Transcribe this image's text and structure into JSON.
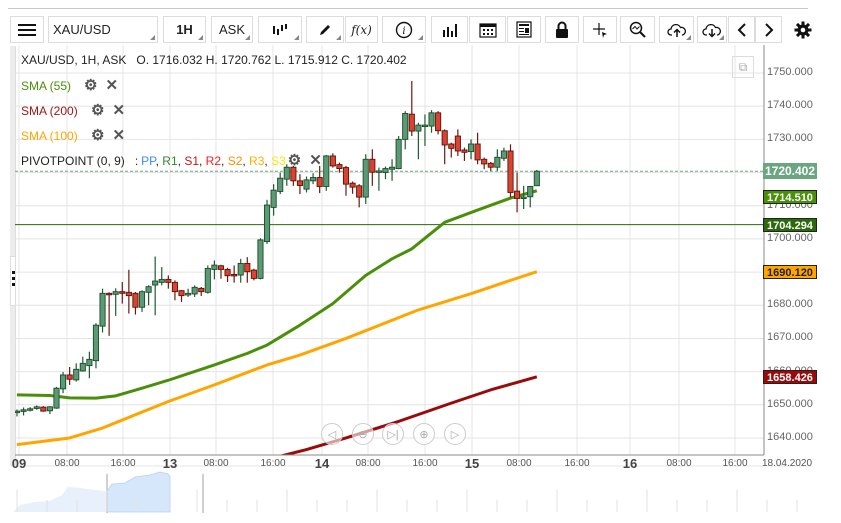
{
  "toolbar": {
    "menu_icon": "hamburger-icon",
    "symbol": "XAU/USD",
    "timeframe": "1H",
    "price_side": "ASK",
    "chart_type_icon": "candlestick-icon",
    "draw_icon": "pencil-icon",
    "indicator_label": "f(x)",
    "info_icon": "info-icon",
    "volume_icon": "bar-chart-icon",
    "calendar_icon": "calendar-icon",
    "news_icon": "newspaper-icon",
    "lock_icon": "lock-icon",
    "crosshair_icon": "crosshair-icon",
    "zoom_icon": "zoom-chart-icon",
    "upload_icon": "cloud-upload-icon",
    "download_icon": "cloud-download-icon",
    "prev_icon": "chevron-left-icon",
    "next_icon": "chevron-right-icon",
    "settings_icon": "gear-icon"
  },
  "header": {
    "title": "XAU/USD, 1H, ASK",
    "ohlc": "O. 1716.032 H. 1720.762 L. 1715.912 C. 1720.402"
  },
  "indicators": [
    {
      "label": "SMA (55)",
      "color": "#4a8f0a"
    },
    {
      "label": "SMA (200)",
      "color": "#a31515"
    },
    {
      "label": "SMA (100)",
      "color": "#ffa500"
    }
  ],
  "pivot": {
    "label": "PIVOTPOINT (0, 9)",
    "sep": ":",
    "levels": [
      {
        "label": "PP",
        "color": "#3b8cff"
      },
      {
        "label": "R1",
        "color": "#2f8a2f"
      },
      {
        "label": "S1",
        "color": "#c01818"
      },
      {
        "label": "R2",
        "color": "#ff1a1a"
      },
      {
        "label": "S2",
        "color": "#ff8c00"
      },
      {
        "label": "R3",
        "color": "#ffb000"
      },
      {
        "label": "S3",
        "color": "#ffe600"
      }
    ]
  },
  "chart_data": {
    "type": "candlestick",
    "ylim": [
      1635,
      1757
    ],
    "y_ticks": [
      "1750.000",
      "1740.000",
      "1730.000",
      "1720.000",
      "1710.000",
      "1700.000",
      "1690.000",
      "1680.000",
      "1670.000",
      "1660.000",
      "1650.000",
      "1640.000"
    ],
    "x_ticks": [
      {
        "label": "09",
        "day": true
      },
      {
        "label": "08:00"
      },
      {
        "label": "16:00"
      },
      {
        "label": "13",
        "day": true
      },
      {
        "label": "08:00"
      },
      {
        "label": "16:00"
      },
      {
        "label": "14",
        "day": true
      },
      {
        "label": "08:00"
      },
      {
        "label": "16:00"
      },
      {
        "label": "15",
        "day": true
      },
      {
        "label": "08:00"
      },
      {
        "label": "16:00"
      },
      {
        "label": "16",
        "day": true
      },
      {
        "label": "08:00"
      },
      {
        "label": "16:00"
      },
      {
        "label": "18.04.2020"
      }
    ],
    "up_color": "#5a9a74",
    "down_color": "#d9432f",
    "candles_ohlc": [
      [
        1647.8,
        1648.6,
        1646.5,
        1648.1
      ],
      [
        1648.0,
        1649.2,
        1646.8,
        1648.5
      ],
      [
        1648.5,
        1649.3,
        1648.0,
        1648.8
      ],
      [
        1648.9,
        1649.8,
        1648.5,
        1649.4
      ],
      [
        1649.3,
        1649.6,
        1647.9,
        1648.1
      ],
      [
        1648.2,
        1649.6,
        1647.2,
        1649.4
      ],
      [
        1649.0,
        1655.4,
        1648.8,
        1655.0
      ],
      [
        1654.8,
        1659.9,
        1653.5,
        1659.0
      ],
      [
        1659.0,
        1661.4,
        1656.0,
        1657.7
      ],
      [
        1657.5,
        1662.5,
        1657.0,
        1660.7
      ],
      [
        1660.2,
        1664.5,
        1660.0,
        1662.5
      ],
      [
        1661.8,
        1666.0,
        1658.0,
        1663.7
      ],
      [
        1663.3,
        1674.6,
        1661.0,
        1674.0
      ],
      [
        1673.7,
        1685.0,
        1671.8,
        1683.6
      ],
      [
        1683.6,
        1683.9,
        1670.8,
        1683.3
      ],
      [
        1683.3,
        1685.1,
        1676.8,
        1684.1
      ],
      [
        1684.1,
        1687.0,
        1680.5,
        1683.6
      ],
      [
        1683.9,
        1690.7,
        1677.5,
        1682.9
      ],
      [
        1683.6,
        1684.0,
        1677.2,
        1679.4
      ],
      [
        1679.4,
        1684.5,
        1678.0,
        1684.1
      ],
      [
        1683.9,
        1686.0,
        1680.0,
        1685.6
      ],
      [
        1686.1,
        1694.7,
        1677.0,
        1687.3
      ],
      [
        1686.9,
        1691.5,
        1686.0,
        1687.8
      ],
      [
        1687.8,
        1689.0,
        1685.0,
        1686.9
      ],
      [
        1686.9,
        1687.5,
        1681.5,
        1684.1
      ],
      [
        1684.4,
        1684.6,
        1681.0,
        1682.9
      ],
      [
        1683.1,
        1685.0,
        1682.5,
        1683.6
      ],
      [
        1683.4,
        1686.0,
        1682.5,
        1685.4
      ],
      [
        1685.1,
        1685.5,
        1682.8,
        1684.1
      ],
      [
        1683.9,
        1692.0,
        1683.5,
        1691.1
      ],
      [
        1690.8,
        1693.5,
        1687.8,
        1692.1
      ],
      [
        1691.9,
        1692.2,
        1688.0,
        1690.8
      ],
      [
        1690.8,
        1691.3,
        1687.0,
        1688.9
      ],
      [
        1689.3,
        1692.0,
        1686.8,
        1688.9
      ],
      [
        1689.1,
        1694.0,
        1686.8,
        1692.6
      ],
      [
        1692.6,
        1694.5,
        1686.8,
        1690.1
      ],
      [
        1690.6,
        1691.0,
        1687.5,
        1688.1
      ],
      [
        1688.1,
        1700.2,
        1687.8,
        1699.7
      ],
      [
        1699.2,
        1711.8,
        1698.5,
        1710.2
      ],
      [
        1709.5,
        1716.5,
        1707.0,
        1714.7
      ],
      [
        1714.3,
        1720.0,
        1713.5,
        1718.3
      ],
      [
        1718.0,
        1722.5,
        1716.0,
        1721.6
      ],
      [
        1721.6,
        1722.0,
        1716.0,
        1717.5
      ],
      [
        1717.5,
        1719.5,
        1713.5,
        1716.1
      ],
      [
        1715.0,
        1718.8,
        1714.0,
        1717.8
      ],
      [
        1717.5,
        1719.8,
        1716.5,
        1718.5
      ],
      [
        1718.5,
        1722.0,
        1713.8,
        1715.8
      ],
      [
        1715.8,
        1725.3,
        1714.5,
        1725.0
      ],
      [
        1725.0,
        1725.8,
        1721.5,
        1722.0
      ],
      [
        1722.4,
        1723.0,
        1720.0,
        1721.2
      ],
      [
        1721.5,
        1722.0,
        1713.0,
        1716.5
      ],
      [
        1716.8,
        1717.3,
        1713.6,
        1715.6
      ],
      [
        1716.0,
        1716.5,
        1709.5,
        1712.6
      ],
      [
        1712.6,
        1725.5,
        1710.5,
        1724.0
      ],
      [
        1724.0,
        1727.0,
        1716.0,
        1720.1
      ],
      [
        1720.3,
        1721.5,
        1714.5,
        1720.5
      ],
      [
        1720.0,
        1721.8,
        1718.0,
        1721.2
      ],
      [
        1721.0,
        1724.0,
        1717.5,
        1721.6
      ],
      [
        1721.2,
        1731.0,
        1721.0,
        1730.0
      ],
      [
        1730.0,
        1738.5,
        1727.0,
        1737.8
      ],
      [
        1737.6,
        1747.6,
        1731.0,
        1732.5
      ],
      [
        1732.5,
        1735.0,
        1724.0,
        1734.3
      ],
      [
        1734.0,
        1737.5,
        1728.0,
        1734.3
      ],
      [
        1734.0,
        1738.8,
        1732.0,
        1738.0
      ],
      [
        1738.0,
        1738.5,
        1731.5,
        1732.6
      ],
      [
        1732.6,
        1733.0,
        1722.5,
        1728.3
      ],
      [
        1728.6,
        1729.0,
        1724.5,
        1727.3
      ],
      [
        1731.0,
        1733.0,
        1725.0,
        1726.5
      ],
      [
        1726.8,
        1727.5,
        1723.5,
        1726.1
      ],
      [
        1726.3,
        1730.0,
        1724.0,
        1728.6
      ],
      [
        1728.6,
        1732.0,
        1722.5,
        1723.8
      ],
      [
        1724.0,
        1724.5,
        1721.0,
        1722.6
      ],
      [
        1722.8,
        1723.2,
        1720.5,
        1721.6
      ],
      [
        1721.6,
        1727.0,
        1720.5,
        1724.6
      ],
      [
        1724.3,
        1727.5,
        1723.5,
        1726.5
      ],
      [
        1726.5,
        1728.5,
        1712.5,
        1714.0
      ],
      [
        1714.4,
        1720.0,
        1708.0,
        1712.2
      ],
      [
        1712.5,
        1716.0,
        1709.0,
        1712.6
      ],
      [
        1712.7,
        1716.0,
        1709.5,
        1715.8
      ],
      [
        1716.032,
        1720.762,
        1715.912,
        1720.402
      ]
    ],
    "series": [
      {
        "name": "SMA (55)",
        "color": "#4a8f0a",
        "points": [
          [
            0,
            1653
          ],
          [
            5,
            1652.8
          ],
          [
            8,
            1652.1
          ],
          [
            12,
            1652
          ],
          [
            15,
            1652.7
          ],
          [
            19,
            1655
          ],
          [
            23,
            1657.4
          ],
          [
            30,
            1662
          ],
          [
            35,
            1665.5
          ],
          [
            38,
            1668
          ],
          [
            43,
            1674
          ],
          [
            48,
            1680.5
          ],
          [
            53,
            1689
          ],
          [
            57,
            1694
          ],
          [
            60,
            1697
          ],
          [
            65,
            1705
          ],
          [
            70,
            1708.7
          ],
          [
            75,
            1712.3
          ],
          [
            79,
            1714.51
          ]
        ]
      },
      {
        "name": "SMA (100)",
        "color": "#ffa500",
        "points": [
          [
            0,
            1638
          ],
          [
            8,
            1640
          ],
          [
            13,
            1643
          ],
          [
            16,
            1645.4
          ],
          [
            23,
            1651
          ],
          [
            30,
            1656
          ],
          [
            38,
            1662
          ],
          [
            43,
            1665
          ],
          [
            50,
            1670
          ],
          [
            61,
            1678.6
          ],
          [
            69,
            1683.5
          ],
          [
            75,
            1687.5
          ],
          [
            79,
            1690.12
          ]
        ]
      },
      {
        "name": "SMA (200)",
        "color": "#9b0a0a",
        "points": [
          [
            38,
            1633.5
          ],
          [
            44,
            1636.5
          ],
          [
            50,
            1640
          ],
          [
            58,
            1645
          ],
          [
            66,
            1650.5
          ],
          [
            72,
            1654.5
          ],
          [
            79,
            1658.426
          ]
        ]
      }
    ],
    "last_price": 1720.402,
    "pivot_pp": 1704.294,
    "price_labels": [
      {
        "value": "1720.402",
        "bg": "#6aa680",
        "fg": "#ffffff"
      },
      {
        "value": "1714.510",
        "bg": "#4a8f0a",
        "fg": "#ffffff"
      },
      {
        "value": "1704.294",
        "bg": "#2a6a0a",
        "fg": "#ffffff"
      },
      {
        "value": "1690.120",
        "bg": "#ffa500",
        "fg": "#222222"
      },
      {
        "value": "1658.426",
        "bg": "#9b0a0a",
        "fg": "#ffffff"
      }
    ]
  },
  "nav_controls": [
    "scroll-left-icon",
    "zoom-out-icon",
    "reset-icon",
    "zoom-in-icon",
    "scroll-right-icon"
  ]
}
